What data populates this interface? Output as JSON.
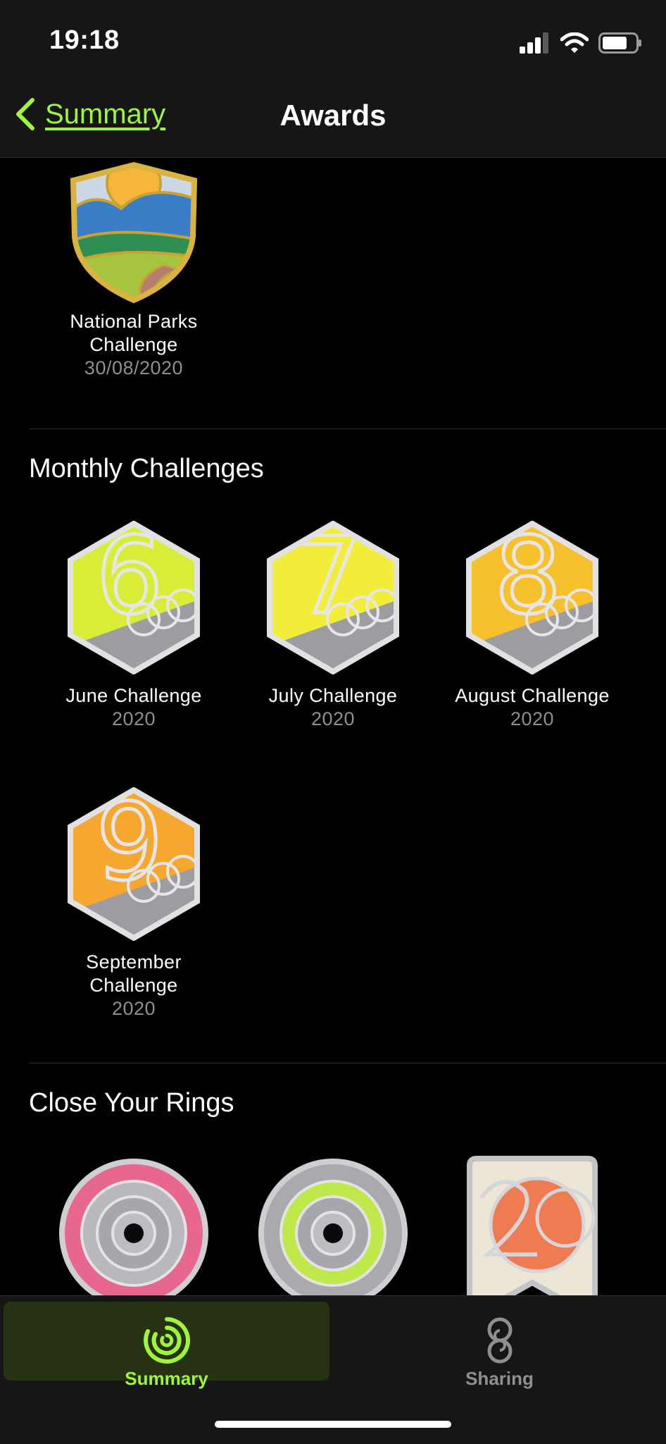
{
  "status_bar": {
    "time": "19:18"
  },
  "nav": {
    "back_label": "Summary",
    "title": "Awards"
  },
  "top_award": {
    "name_line1": "National Parks",
    "name_line2": "Challenge",
    "date": "30/08/2020"
  },
  "monthly": {
    "title": "Monthly Challenges",
    "items": [
      {
        "name": "June Challenge",
        "year": "2020",
        "digit": "6",
        "color": "#d9ec38"
      },
      {
        "name": "July Challenge",
        "year": "2020",
        "digit": "7",
        "color": "#f2ec3a"
      },
      {
        "name": "August Challenge",
        "year": "2020",
        "digit": "8",
        "color": "#f7c12e"
      },
      {
        "name_line1": "September",
        "name_line2": "Challenge",
        "year": "2020",
        "digit": "9",
        "color": "#f5a72f"
      }
    ]
  },
  "rings": {
    "title": "Close Your Rings"
  },
  "tabs": [
    {
      "label": "Summary",
      "active": true,
      "color": "#9ef53a"
    },
    {
      "label": "Sharing",
      "active": false,
      "color": "#8e8e93"
    }
  ]
}
